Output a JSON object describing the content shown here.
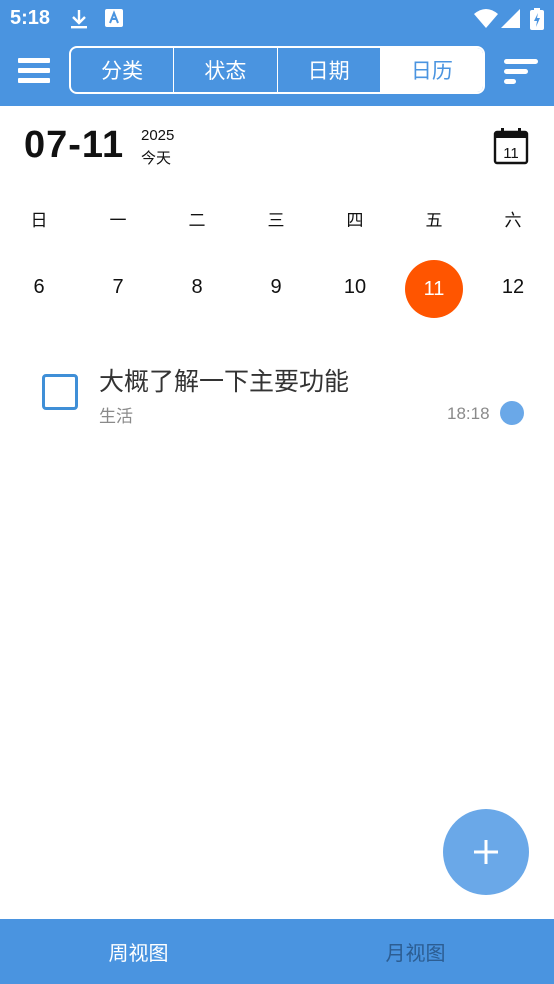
{
  "status_bar": {
    "time": "5:18",
    "icons": [
      "download-icon",
      "a-badge-icon",
      "wifi-icon",
      "signal-icon",
      "battery-icon"
    ]
  },
  "appbar": {
    "menu_icon": "hamburger-icon",
    "sort_icon": "sort-lines-icon",
    "tabs": [
      {
        "label": "分类",
        "active": false
      },
      {
        "label": "状态",
        "active": false
      },
      {
        "label": "日期",
        "active": false
      },
      {
        "label": "日历",
        "active": true
      }
    ]
  },
  "date_header": {
    "date": "07-11",
    "year": "2025",
    "today": "今天",
    "calendar_day": "11"
  },
  "week": {
    "weekdays": [
      "日",
      "一",
      "二",
      "三",
      "四",
      "五",
      "六"
    ],
    "days": [
      "6",
      "7",
      "8",
      "9",
      "10",
      "11",
      "12"
    ],
    "selected_index": 5
  },
  "tasks": [
    {
      "title": "大概了解一下主要功能",
      "category": "生活",
      "time": "18:18",
      "done": false
    }
  ],
  "fab": {
    "icon": "plus-icon"
  },
  "bottom_tabs": [
    {
      "label": "周视图",
      "active": true
    },
    {
      "label": "月视图",
      "active": false
    }
  ],
  "colors": {
    "primary": "#4a94e0",
    "selected_day": "#ff5500",
    "fab": "#6aa8e8",
    "checkbox": "#3f8fd7"
  }
}
